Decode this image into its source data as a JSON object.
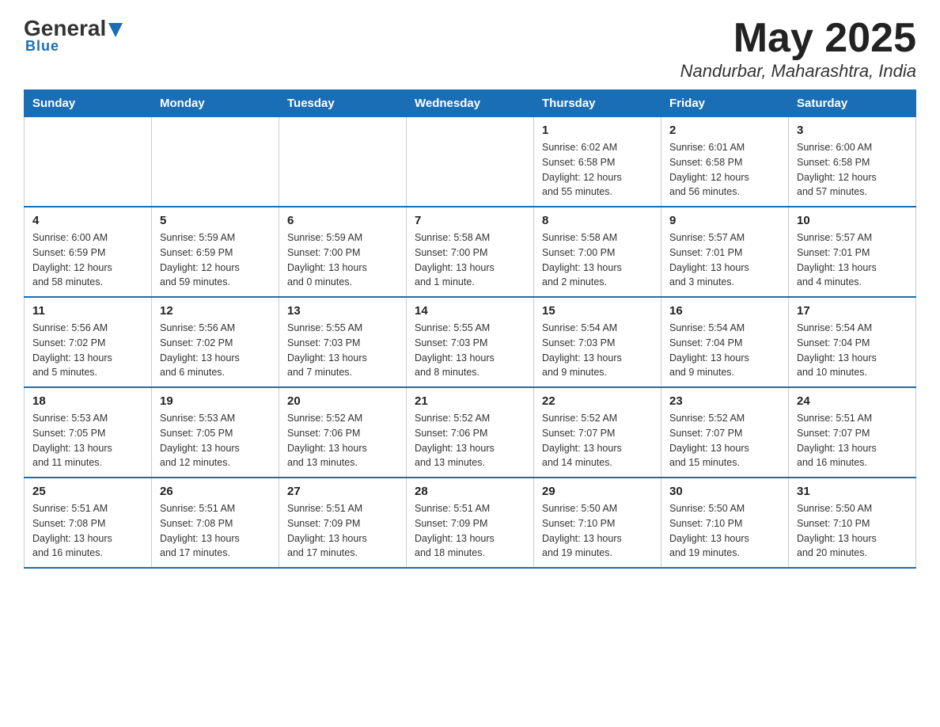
{
  "header": {
    "logo_general": "General",
    "logo_blue": "Blue",
    "month_title": "May 2025",
    "location": "Nandurbar, Maharashtra, India"
  },
  "days_of_week": [
    "Sunday",
    "Monday",
    "Tuesday",
    "Wednesday",
    "Thursday",
    "Friday",
    "Saturday"
  ],
  "weeks": [
    [
      {
        "day": "",
        "info": ""
      },
      {
        "day": "",
        "info": ""
      },
      {
        "day": "",
        "info": ""
      },
      {
        "day": "",
        "info": ""
      },
      {
        "day": "1",
        "info": "Sunrise: 6:02 AM\nSunset: 6:58 PM\nDaylight: 12 hours\nand 55 minutes."
      },
      {
        "day": "2",
        "info": "Sunrise: 6:01 AM\nSunset: 6:58 PM\nDaylight: 12 hours\nand 56 minutes."
      },
      {
        "day": "3",
        "info": "Sunrise: 6:00 AM\nSunset: 6:58 PM\nDaylight: 12 hours\nand 57 minutes."
      }
    ],
    [
      {
        "day": "4",
        "info": "Sunrise: 6:00 AM\nSunset: 6:59 PM\nDaylight: 12 hours\nand 58 minutes."
      },
      {
        "day": "5",
        "info": "Sunrise: 5:59 AM\nSunset: 6:59 PM\nDaylight: 12 hours\nand 59 minutes."
      },
      {
        "day": "6",
        "info": "Sunrise: 5:59 AM\nSunset: 7:00 PM\nDaylight: 13 hours\nand 0 minutes."
      },
      {
        "day": "7",
        "info": "Sunrise: 5:58 AM\nSunset: 7:00 PM\nDaylight: 13 hours\nand 1 minute."
      },
      {
        "day": "8",
        "info": "Sunrise: 5:58 AM\nSunset: 7:00 PM\nDaylight: 13 hours\nand 2 minutes."
      },
      {
        "day": "9",
        "info": "Sunrise: 5:57 AM\nSunset: 7:01 PM\nDaylight: 13 hours\nand 3 minutes."
      },
      {
        "day": "10",
        "info": "Sunrise: 5:57 AM\nSunset: 7:01 PM\nDaylight: 13 hours\nand 4 minutes."
      }
    ],
    [
      {
        "day": "11",
        "info": "Sunrise: 5:56 AM\nSunset: 7:02 PM\nDaylight: 13 hours\nand 5 minutes."
      },
      {
        "day": "12",
        "info": "Sunrise: 5:56 AM\nSunset: 7:02 PM\nDaylight: 13 hours\nand 6 minutes."
      },
      {
        "day": "13",
        "info": "Sunrise: 5:55 AM\nSunset: 7:03 PM\nDaylight: 13 hours\nand 7 minutes."
      },
      {
        "day": "14",
        "info": "Sunrise: 5:55 AM\nSunset: 7:03 PM\nDaylight: 13 hours\nand 8 minutes."
      },
      {
        "day": "15",
        "info": "Sunrise: 5:54 AM\nSunset: 7:03 PM\nDaylight: 13 hours\nand 9 minutes."
      },
      {
        "day": "16",
        "info": "Sunrise: 5:54 AM\nSunset: 7:04 PM\nDaylight: 13 hours\nand 9 minutes."
      },
      {
        "day": "17",
        "info": "Sunrise: 5:54 AM\nSunset: 7:04 PM\nDaylight: 13 hours\nand 10 minutes."
      }
    ],
    [
      {
        "day": "18",
        "info": "Sunrise: 5:53 AM\nSunset: 7:05 PM\nDaylight: 13 hours\nand 11 minutes."
      },
      {
        "day": "19",
        "info": "Sunrise: 5:53 AM\nSunset: 7:05 PM\nDaylight: 13 hours\nand 12 minutes."
      },
      {
        "day": "20",
        "info": "Sunrise: 5:52 AM\nSunset: 7:06 PM\nDaylight: 13 hours\nand 13 minutes."
      },
      {
        "day": "21",
        "info": "Sunrise: 5:52 AM\nSunset: 7:06 PM\nDaylight: 13 hours\nand 13 minutes."
      },
      {
        "day": "22",
        "info": "Sunrise: 5:52 AM\nSunset: 7:07 PM\nDaylight: 13 hours\nand 14 minutes."
      },
      {
        "day": "23",
        "info": "Sunrise: 5:52 AM\nSunset: 7:07 PM\nDaylight: 13 hours\nand 15 minutes."
      },
      {
        "day": "24",
        "info": "Sunrise: 5:51 AM\nSunset: 7:07 PM\nDaylight: 13 hours\nand 16 minutes."
      }
    ],
    [
      {
        "day": "25",
        "info": "Sunrise: 5:51 AM\nSunset: 7:08 PM\nDaylight: 13 hours\nand 16 minutes."
      },
      {
        "day": "26",
        "info": "Sunrise: 5:51 AM\nSunset: 7:08 PM\nDaylight: 13 hours\nand 17 minutes."
      },
      {
        "day": "27",
        "info": "Sunrise: 5:51 AM\nSunset: 7:09 PM\nDaylight: 13 hours\nand 17 minutes."
      },
      {
        "day": "28",
        "info": "Sunrise: 5:51 AM\nSunset: 7:09 PM\nDaylight: 13 hours\nand 18 minutes."
      },
      {
        "day": "29",
        "info": "Sunrise: 5:50 AM\nSunset: 7:10 PM\nDaylight: 13 hours\nand 19 minutes."
      },
      {
        "day": "30",
        "info": "Sunrise: 5:50 AM\nSunset: 7:10 PM\nDaylight: 13 hours\nand 19 minutes."
      },
      {
        "day": "31",
        "info": "Sunrise: 5:50 AM\nSunset: 7:10 PM\nDaylight: 13 hours\nand 20 minutes."
      }
    ]
  ]
}
